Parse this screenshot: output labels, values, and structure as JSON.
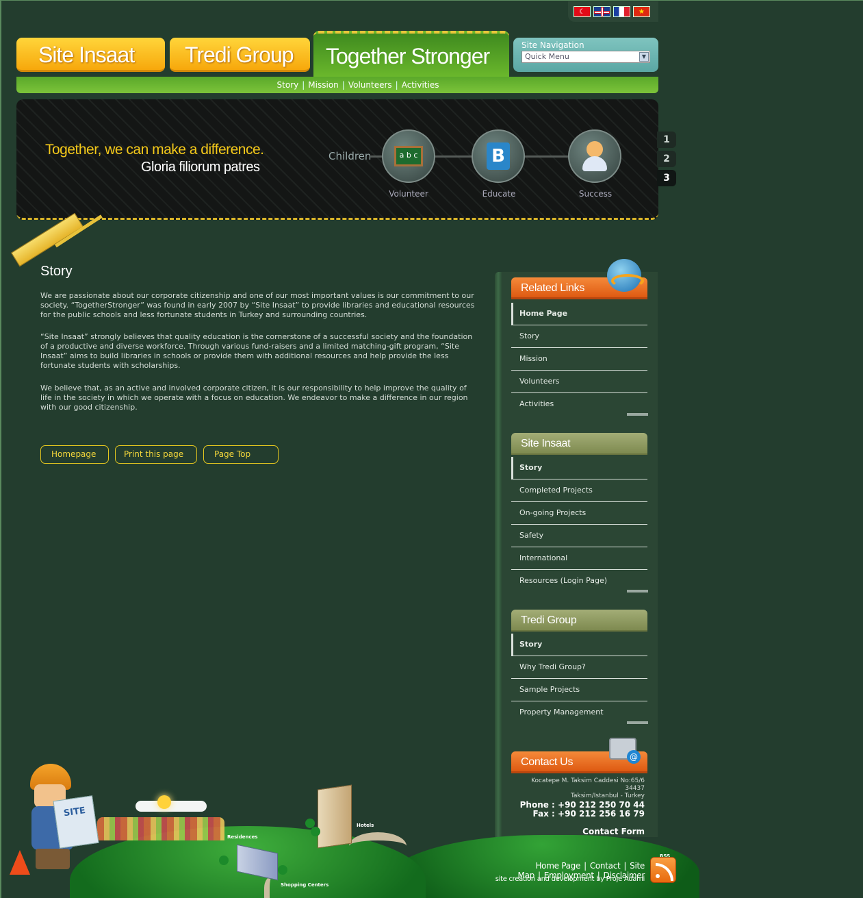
{
  "flags": [
    {
      "name": "turkey-flag-icon",
      "glyph": "☾"
    },
    {
      "name": "uk-flag-icon",
      "glyph": ""
    },
    {
      "name": "france-flag-icon",
      "glyph": ""
    },
    {
      "name": "china-flag-icon",
      "glyph": "★"
    }
  ],
  "tabs": {
    "site_insaat": "Site Insaat",
    "tredi_group": "Tredi Group",
    "together_stronger": "Together Stronger"
  },
  "site_navigation": {
    "title": "Site Navigation",
    "selected": "Quick Menu",
    "arrow": "▼"
  },
  "subnav": [
    "Story",
    "Mission",
    "Volunteers",
    "Activities"
  ],
  "subnav_separator": "|",
  "banner": {
    "slogan": "Together, we can make a difference.",
    "subtitle": "Gloria filiorum patres",
    "start_label": "Children",
    "steps": [
      {
        "label": "Volunteer",
        "icon": "chalkboard-icon"
      },
      {
        "label": "Educate",
        "icon": "book-icon"
      },
      {
        "label": "Success",
        "icon": "user-icon"
      }
    ],
    "board_text": "a b c",
    "book_letter": "B",
    "pages": [
      "1",
      "2",
      "3"
    ],
    "active_page": "3"
  },
  "main": {
    "title": "Story",
    "paragraphs": [
      "We are passionate about our corporate citizenship and one of our most important values is our commitment to our society.  “TogetherStronger”  was found in early 2007 by  “Site Insaat”  to provide libraries and educational resources for the public schools and less fortunate students in Turkey and surrounding countries.",
      " “Site Insaat”  strongly believes that quality education is the cornerstone of a successful society and the foundation of a productive and diverse workforce. Through various fund-raisers and a limited matching-gift program,  “Site Insaat”  aims to build libraries in schools or provide them with additional resources and help provide the less fortunate students with scholarships.",
      "We believe that, as an active and involved corporate citizen, it is our responsibility to help improve the quality of life in the society in which we operate with a focus on education.  We endeavor to make a difference in our region with our good citizenship."
    ],
    "buttons": {
      "homepage": "Homepage",
      "print": "Print this page",
      "top": "Page Top"
    }
  },
  "sidebar": {
    "related_links": {
      "title": "Related Links",
      "items": [
        "Home Page",
        "Story",
        "Mission",
        "Volunteers",
        "Activities"
      ]
    },
    "site_insaat": {
      "title": "Site Insaat",
      "items": [
        "Story",
        "Completed Projects",
        "On-going Projects",
        "Safety",
        "International",
        "Resources (Login Page)"
      ]
    },
    "tredi_group": {
      "title": "Tredi Group",
      "items": [
        "Story",
        "Why Tredi Group?",
        "Sample Projects",
        "Property Management"
      ]
    },
    "contact": {
      "title": "Contact Us",
      "address1": "Kocatepe M. Taksim Caddesi No:65/6 34437",
      "address2": "Taksim/Istanbul - Turkey",
      "phone": "Phone : +90 212 250 70 44",
      "fax": "Fax : +90 212 256 16 79",
      "form": "Contact Form",
      "at_glyph": "@"
    }
  },
  "illustration": {
    "residences": "Residences",
    "hotels": "Hotels",
    "shopping": "Shopping Centers",
    "sign": "SITE"
  },
  "footer": {
    "links": [
      "Home Page",
      "Contact",
      "Site Map",
      "Employment",
      "Disclaimer"
    ],
    "credits": "site creation and development by Proje Adami",
    "rss": "RSS"
  },
  "colors": {
    "background": "#233d2e",
    "tab_yellow": "#f7a80c",
    "tab_green": "#6bb82c",
    "accent_orange": "#de5a12",
    "olive": "#7e8a50",
    "button_border": "#e3c61f"
  }
}
